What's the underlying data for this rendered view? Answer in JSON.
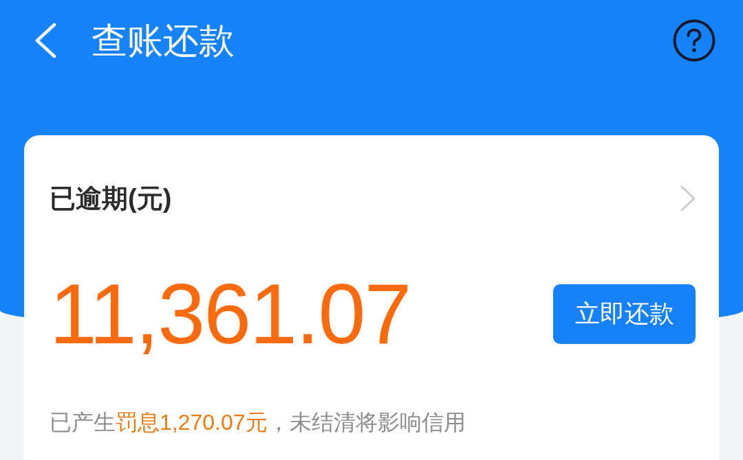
{
  "header": {
    "title": "查账还款"
  },
  "card": {
    "heading": "已逾期(元)",
    "amount": "11,361.07",
    "button": "立即还款",
    "notice": [
      {
        "text": "已产生",
        "highlight": false
      },
      {
        "text": "罚息1,270.07元",
        "highlight": true
      },
      {
        "text": "，未结清将影响信用",
        "highlight": false
      }
    ]
  }
}
